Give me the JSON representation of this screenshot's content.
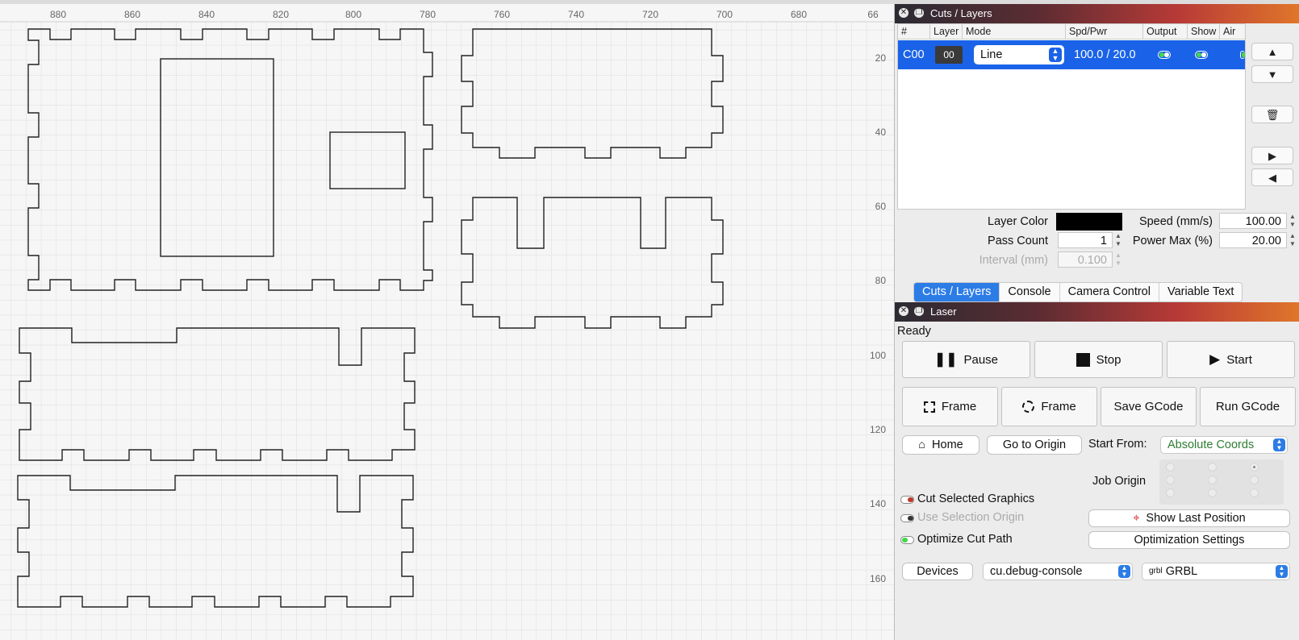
{
  "ruler": {
    "top_labels": [
      "880",
      "860",
      "840",
      "820",
      "800",
      "780",
      "760",
      "740",
      "720",
      "700",
      "680",
      "66"
    ],
    "right_labels": [
      "20",
      "40",
      "60",
      "80",
      "100",
      "120",
      "140",
      "160"
    ]
  },
  "cuts_panel": {
    "title": "Cuts / Layers",
    "columns": [
      "#",
      "Layer",
      "Mode",
      "Spd/Pwr",
      "Output",
      "Show",
      "Air"
    ],
    "row": {
      "id": "C00",
      "layer": "00",
      "mode": "Line",
      "spd_pwr": "100.0 / 20.0"
    },
    "side_buttons": {
      "up": "⌃",
      "down": "⌄",
      "delete": "🗑",
      "right": "›",
      "left": "‹"
    },
    "props": {
      "layer_color_label": "Layer Color",
      "layer_color": "#000000",
      "pass_count_label": "Pass Count",
      "pass_count": "1",
      "interval_label": "Interval (mm)",
      "interval": "0.100",
      "speed_label": "Speed (mm/s)",
      "speed": "100.00",
      "power_label": "Power Max (%)",
      "power": "20.00"
    },
    "tabs": [
      "Cuts / Layers",
      "Console",
      "Camera Control",
      "Variable Text"
    ]
  },
  "laser_panel": {
    "title": "Laser",
    "status": "Ready",
    "pause": "Pause",
    "stop": "Stop",
    "start": "Start",
    "frame1": "Frame",
    "frame2": "Frame",
    "save_gcode": "Save GCode",
    "run_gcode": "Run GCode",
    "home": "Home",
    "go_to_origin": "Go to Origin",
    "start_from_label": "Start From:",
    "start_from": "Absolute Coords",
    "job_origin_label": "Job Origin",
    "cut_selected": "Cut Selected Graphics",
    "use_selection_origin": "Use Selection Origin",
    "optimize_cut_path": "Optimize Cut Path",
    "show_last_position": "Show Last Position",
    "optimization_settings": "Optimization Settings",
    "devices": "Devices",
    "device_select": "cu.debug-console",
    "controller_select": "GRBL",
    "controller_logo": "grbl"
  },
  "colors": {
    "selection": "#1a63e8",
    "accent": "#2c7ce6",
    "start_from_text": "#2e7d32"
  }
}
